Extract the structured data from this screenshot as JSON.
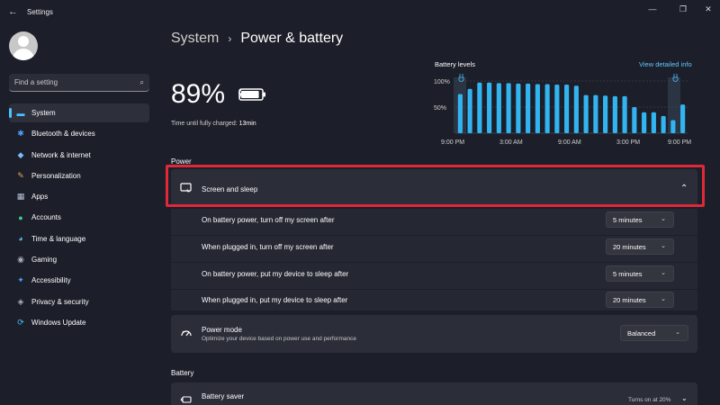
{
  "window": {
    "title": "Settings",
    "back_glyph": "←",
    "minimize": "—",
    "restore": "❐",
    "close": "✕"
  },
  "search": {
    "placeholder": "Find a setting",
    "icon": "search-icon"
  },
  "nav": {
    "items": [
      {
        "label": "System",
        "icon": "monitor-icon",
        "glyph": "▬",
        "color": "#4cc2ff",
        "active": true
      },
      {
        "label": "Bluetooth & devices",
        "icon": "bluetooth-icon",
        "glyph": "✱",
        "color": "#4c9eff"
      },
      {
        "label": "Network & internet",
        "icon": "wifi-icon",
        "glyph": "◆",
        "color": "#7fb8ff"
      },
      {
        "label": "Personalization",
        "icon": "brush-icon",
        "glyph": "✎",
        "color": "#e8a25a"
      },
      {
        "label": "Apps",
        "icon": "apps-icon",
        "glyph": "▦",
        "color": "#b8c4d8"
      },
      {
        "label": "Accounts",
        "icon": "person-icon",
        "glyph": "●",
        "color": "#3ccf8e"
      },
      {
        "label": "Time & language",
        "icon": "globe-icon",
        "glyph": "◕",
        "color": "#5ab4f0"
      },
      {
        "label": "Gaming",
        "icon": "controller-icon",
        "glyph": "◉",
        "color": "#a8b0c0"
      },
      {
        "label": "Accessibility",
        "icon": "accessibility-icon",
        "glyph": "✦",
        "color": "#4c9eff"
      },
      {
        "label": "Privacy & security",
        "icon": "shield-icon",
        "glyph": "◈",
        "color": "#a8b0c0"
      },
      {
        "label": "Windows Update",
        "icon": "update-icon",
        "glyph": "⟳",
        "color": "#4cc2ff"
      }
    ]
  },
  "breadcrumb": {
    "parent": "System",
    "separator": "›",
    "current": "Power & battery"
  },
  "battery": {
    "percent": "89%",
    "level": 0.89,
    "charge_label": "Time until fully charged:",
    "charge_value": "13min"
  },
  "chart_data": {
    "type": "bar",
    "title": "Battery levels",
    "link": "View detailed info",
    "y_ticks": [
      "100%",
      "50%"
    ],
    "x_labels": [
      "9:00 PM",
      "3:00 AM",
      "9:00 AM",
      "3:00 PM",
      "9:00 PM"
    ],
    "values": [
      75,
      85,
      97,
      97,
      96,
      96,
      95,
      95,
      94,
      94,
      93,
      93,
      91,
      73,
      73,
      72,
      71,
      71,
      50,
      40,
      40,
      33,
      25,
      55
    ],
    "ylim": [
      0,
      100
    ],
    "color": "#32b4f0"
  },
  "sections": {
    "power": "Power",
    "battery": "Battery"
  },
  "screen_sleep": {
    "title": "Screen and sleep",
    "icon": "screen-sleep-icon",
    "chevron": "⌃",
    "rows": [
      {
        "label": "On battery power, turn off my screen after",
        "value": "5 minutes"
      },
      {
        "label": "When plugged in, turn off my screen after",
        "value": "20 minutes"
      },
      {
        "label": "On battery power, put my device to sleep after",
        "value": "5 minutes"
      },
      {
        "label": "When plugged in, put my device to sleep after",
        "value": "20 minutes"
      }
    ],
    "dropdown_chevron": "⌄"
  },
  "power_mode": {
    "title": "Power mode",
    "subtitle": "Optimize your device based on power use and performance",
    "value": "Balanced",
    "icon": "power-mode-icon"
  },
  "battery_saver": {
    "title": "Battery saver",
    "status": "Turns on at 20%",
    "icon": "battery-saver-icon"
  }
}
